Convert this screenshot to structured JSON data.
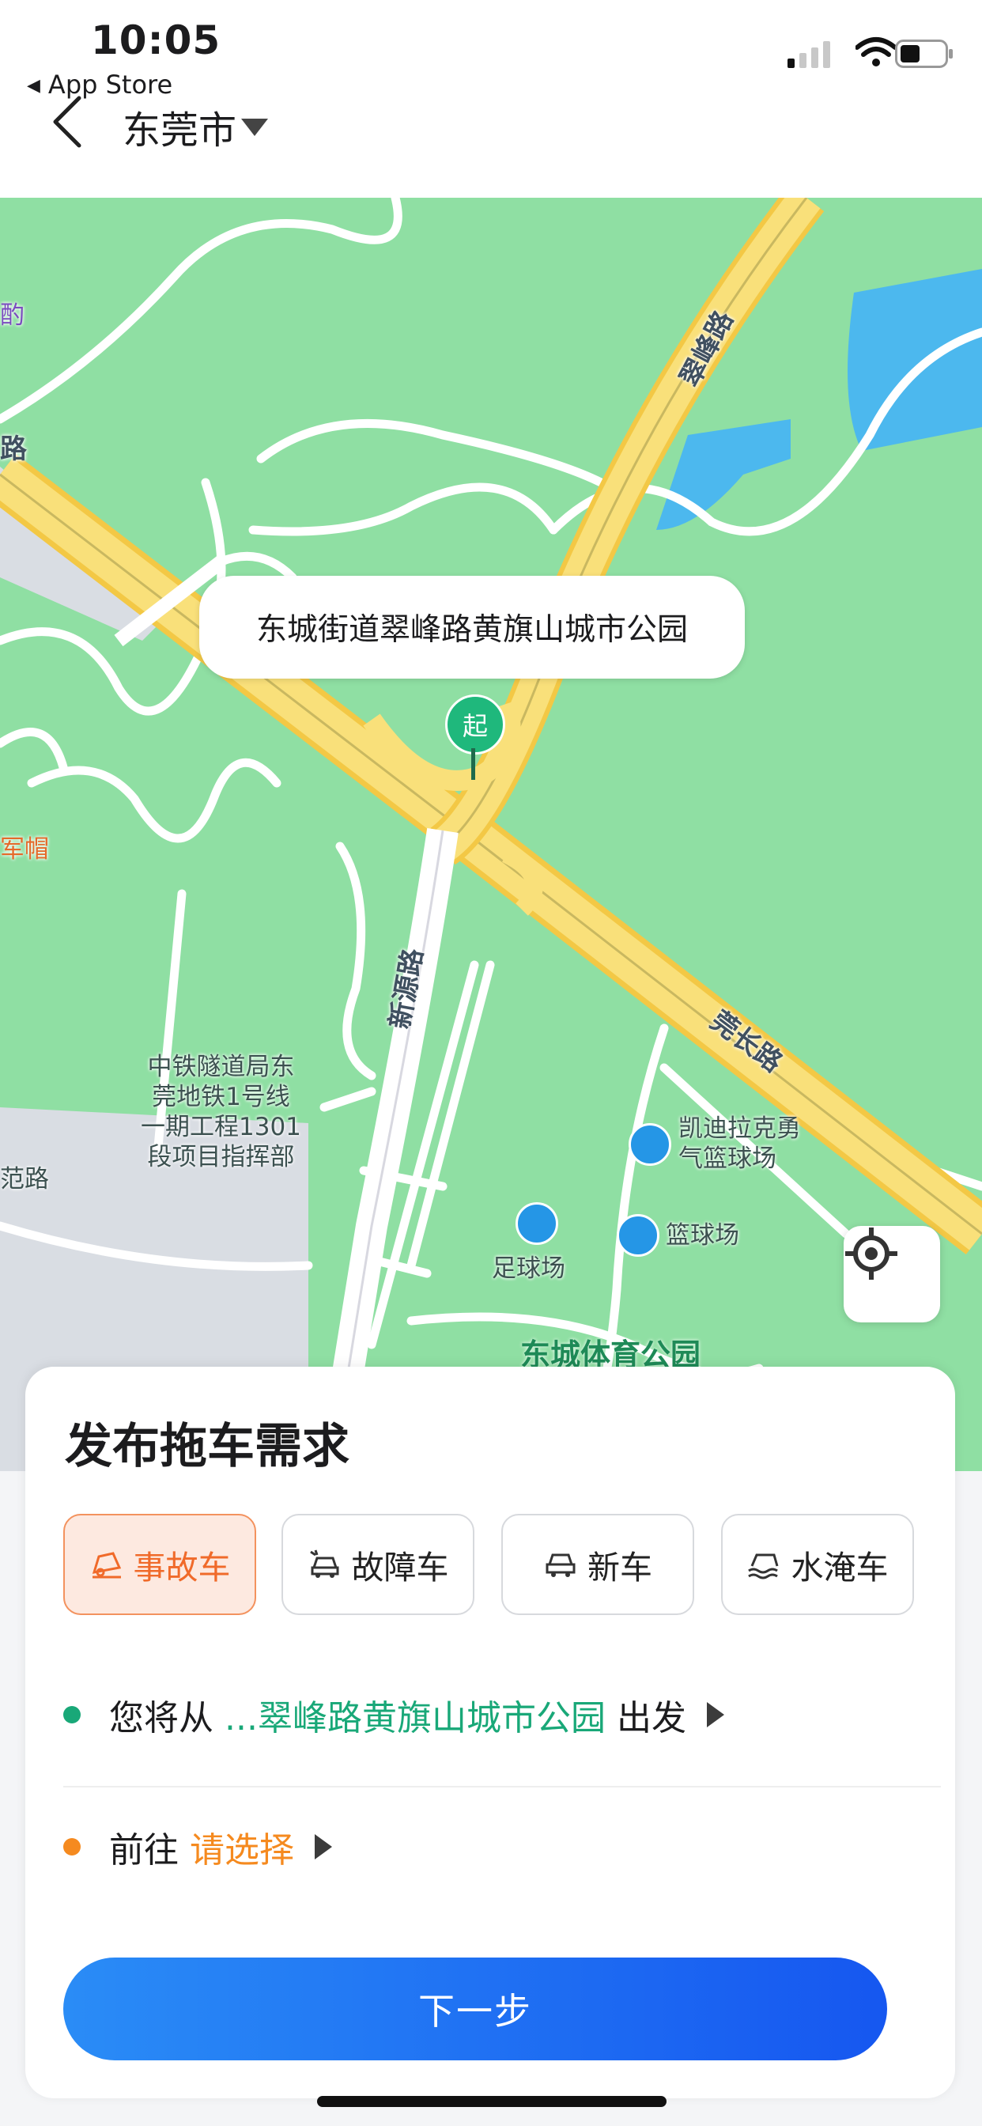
{
  "status_bar": {
    "time": "10:05",
    "back_app": "App Store"
  },
  "nav": {
    "city": "东莞市"
  },
  "map": {
    "callout": "东城街道翠峰路黄旗山城市公园",
    "start_pin": "起",
    "roads": [
      "翠峰路",
      "新源路",
      "莞长路"
    ],
    "pois": {
      "tunnel_bureau": [
        "中铁隧道局东",
        "莞地铁1号线",
        "一期工程1301",
        "段项目指挥部"
      ],
      "cadillac": [
        "凯迪拉克勇",
        "气篮球场"
      ],
      "basketball": "篮球场",
      "football": "足球场",
      "park": "东城体育公园",
      "edge_left_1": "酌",
      "edge_left_2": "路",
      "edge_left_3": "军帽",
      "edge_left_4": "范路"
    }
  },
  "panel": {
    "title": "发布拖车需求",
    "vehicle_types": [
      {
        "label": "事故车",
        "icon": "accident-car-icon",
        "selected": true
      },
      {
        "label": "故障车",
        "icon": "breakdown-car-icon",
        "selected": false
      },
      {
        "label": "新车",
        "icon": "new-car-icon",
        "selected": false
      },
      {
        "label": "水淹车",
        "icon": "flooded-car-icon",
        "selected": false
      }
    ],
    "from": {
      "prefix": "您将从",
      "place": "...翠峰路黄旗山城市公园",
      "suffix": "出发"
    },
    "to": {
      "prefix": "前往",
      "placeholder": "请选择"
    },
    "next_button": "下一步"
  },
  "colors": {
    "accent_blue": "#1f6ff3",
    "green": "#19a878",
    "orange": "#f58a1f",
    "map_green": "#8fdfa3",
    "road_yellow": "#f7d85a"
  }
}
